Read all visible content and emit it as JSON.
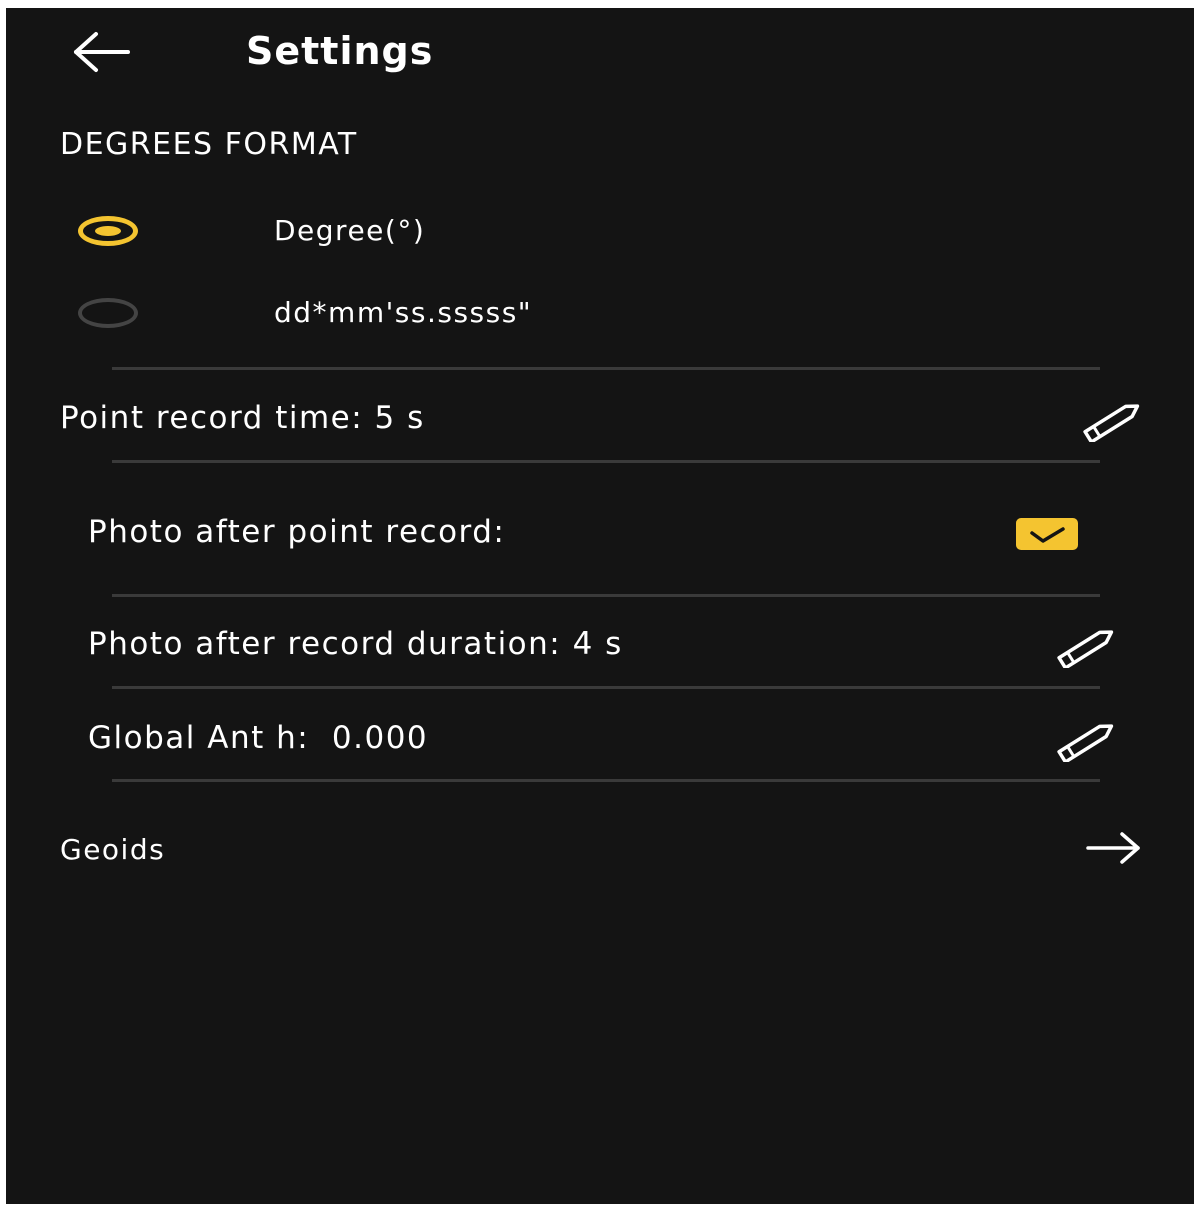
{
  "header": {
    "title": "Settings",
    "back_icon": "arrow-left-icon"
  },
  "degrees_format": {
    "section_title": "DEGREES FORMAT",
    "options": [
      {
        "label": "Degree(°)",
        "selected": true
      },
      {
        "label": "dd*mm'ss.sssss\"",
        "selected": false
      }
    ]
  },
  "settings": {
    "point_record_time": {
      "label": "Point record time: 5 s",
      "icon": "pencil-icon"
    },
    "photo_after_point_record": {
      "label": "Photo after point record:",
      "checked": true
    },
    "photo_after_record_duration": {
      "label": "Photo after record duration: 4 s",
      "icon": "pencil-icon"
    },
    "global_ant_h": {
      "label": "Global Ant h:  0.000",
      "icon": "pencil-icon"
    },
    "geoids": {
      "label": "Geoids",
      "icon": "arrow-right-icon"
    }
  },
  "colors": {
    "background": "#141414",
    "accent": "#f4c430",
    "divider": "#3a3a3a",
    "text": "#ffffff"
  }
}
